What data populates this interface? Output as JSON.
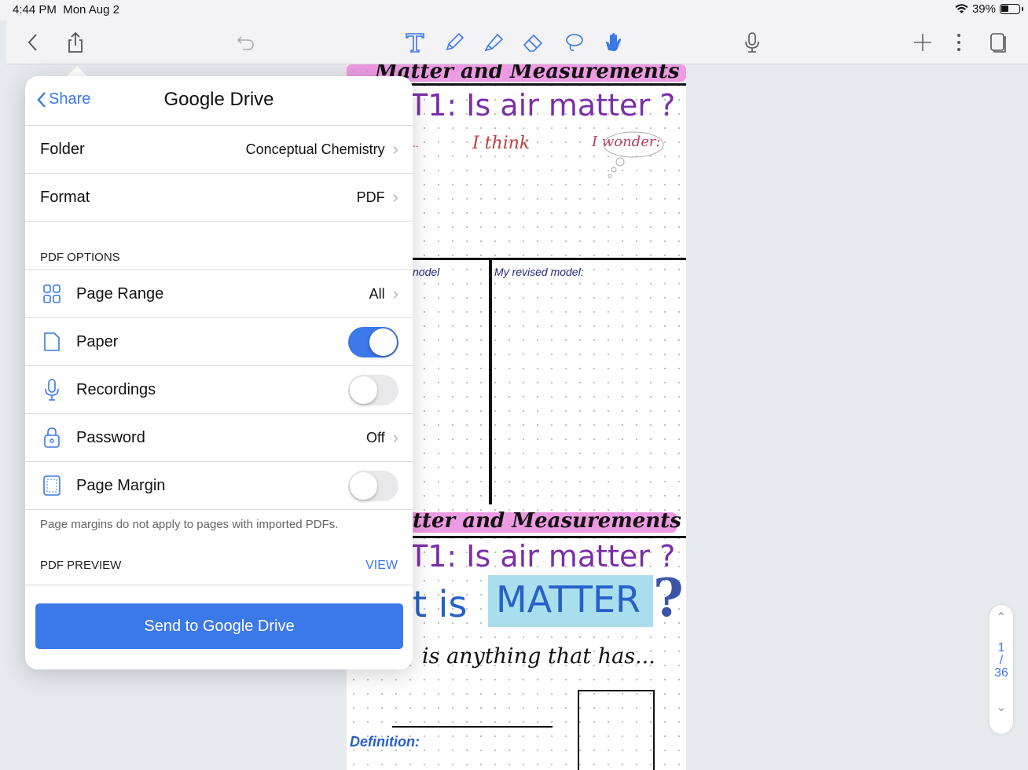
{
  "status_bar": {
    "time": "4:44 PM",
    "date": "Mon Aug 2",
    "battery": "39%"
  },
  "toolbar": {
    "icons": [
      "back-icon",
      "share-icon",
      "undo-icon",
      "text-tool-icon",
      "pen-icon",
      "highlighter-icon",
      "eraser-icon",
      "lasso-icon",
      "hand-icon",
      "microphone-icon",
      "add-icon",
      "more-icon",
      "pages-icon"
    ],
    "accent": "#3b78e8"
  },
  "share_panel": {
    "back_label": "Share",
    "title": "Google Drive",
    "folder": {
      "label": "Folder",
      "value": "Conceptual Chemistry"
    },
    "format": {
      "label": "Format",
      "value": "PDF"
    },
    "pdf_options_header": "PDF OPTIONS",
    "options": {
      "page_range": {
        "label": "Page Range",
        "value": "All"
      },
      "paper": {
        "label": "Paper",
        "enabled": true
      },
      "recordings": {
        "label": "Recordings",
        "enabled": false
      },
      "password": {
        "label": "Password",
        "value": "Off"
      },
      "page_margin": {
        "label": "Page Margin",
        "enabled": false
      }
    },
    "margin_note": "Page margins do not apply to pages with imported PDFs.",
    "preview_header": "PDF PREVIEW",
    "preview_action": "VIEW",
    "send_button": "Send to Google Drive"
  },
  "notebook": {
    "heading1": "Matter and Measurements",
    "heading1_visible": "Matter and Measurements",
    "prompt1": "T1: Is air matter ?",
    "think": "I think",
    "wonder": "I wonder:",
    "ellipsis": "..",
    "model_left": "nodel",
    "model_right": "My revised model:",
    "heading2": "tter and Measurements",
    "prompt2": "T1: Is air matter ?",
    "what_is": "t is",
    "matter_word": "MATTER",
    "question_mark": "?",
    "anything": "is anything that has...",
    "definition": "Definition:"
  },
  "pager": {
    "current": "1",
    "slash": "/",
    "total": "36"
  }
}
